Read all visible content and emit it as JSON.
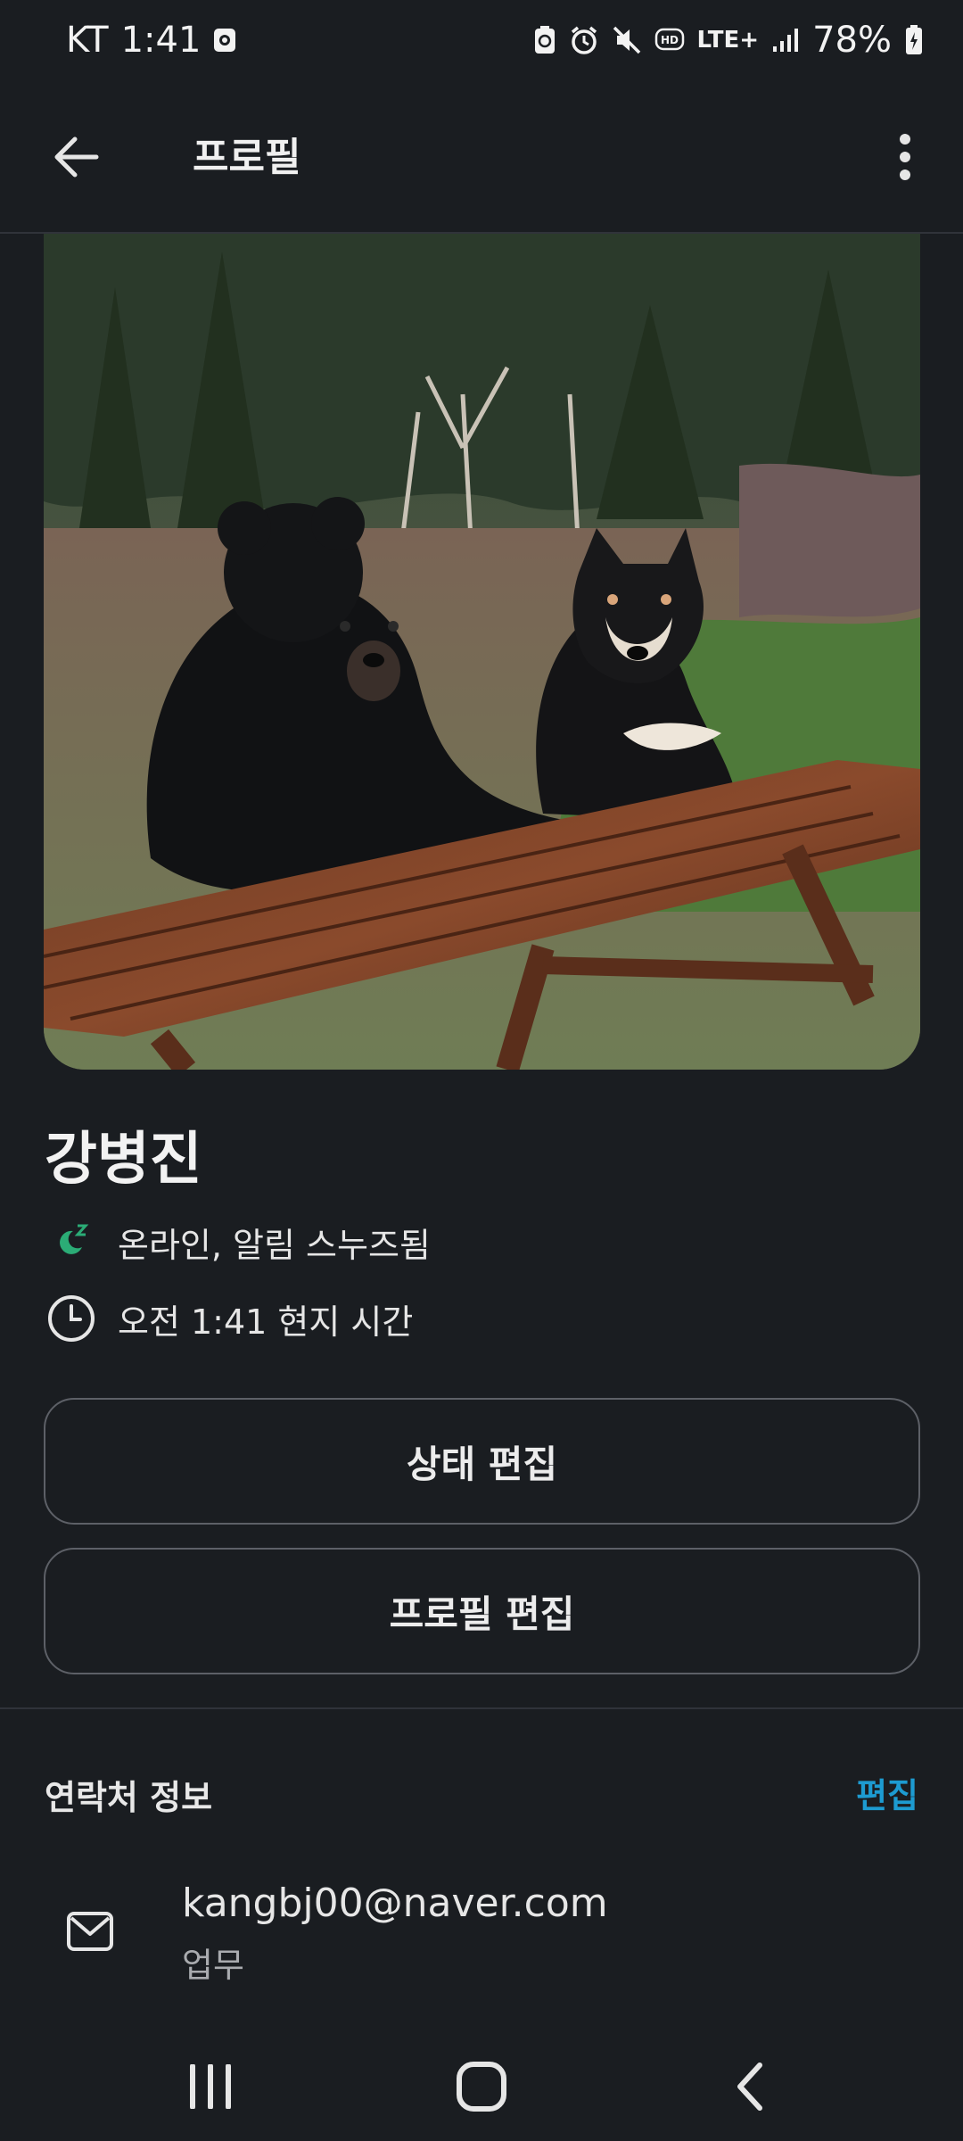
{
  "status_bar": {
    "carrier": "KT",
    "time": "1:41",
    "network": "LTE+",
    "battery": "78%"
  },
  "header": {
    "title": "프로필"
  },
  "profile": {
    "photo_description_icon": "bear-and-dog-photo",
    "name": "강병진",
    "status_text": "온라인, 알림 스누즈됨",
    "local_time_text": "오전 1:41 현지 시간",
    "status_color": "#2bac76"
  },
  "actions": {
    "edit_status_label": "상태 편집",
    "edit_profile_label": "프로필 편집"
  },
  "contact": {
    "section_title": "연락처 정보",
    "edit_label": "편집",
    "accent_color": "#1d9bd1",
    "items": [
      {
        "icon": "mail-icon",
        "value": "kangbj00@naver.com",
        "type": "업무"
      }
    ]
  },
  "icons": {
    "back": "arrow-left-icon",
    "more": "more-vertical-icon",
    "snooze": "snooze-icon",
    "clock": "clock-icon",
    "mail": "mail-icon",
    "nav_recent": "recent-apps-icon",
    "nav_home": "home-icon",
    "nav_back": "nav-back-icon"
  }
}
